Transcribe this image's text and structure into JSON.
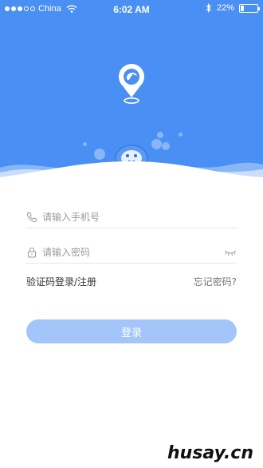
{
  "status_bar": {
    "carrier": "China",
    "time": "6:02 AM",
    "battery_percent": "22%",
    "battery_level": 0.22
  },
  "login": {
    "phone_placeholder": "请输入手机号",
    "password_placeholder": "请输入密码",
    "sms_login_link": "验证码登录/注册",
    "forgot_password_link": "忘记密码?",
    "login_button": "登录"
  },
  "colors": {
    "brand_blue": "#4a8ff3",
    "button_blue": "#a3c5fa"
  },
  "icons": [
    "wifi-icon",
    "bluetooth-icon",
    "battery-icon",
    "location-pin-logo",
    "phone-icon",
    "lock-icon",
    "eye-closed-icon"
  ],
  "watermark": "husay.cn"
}
